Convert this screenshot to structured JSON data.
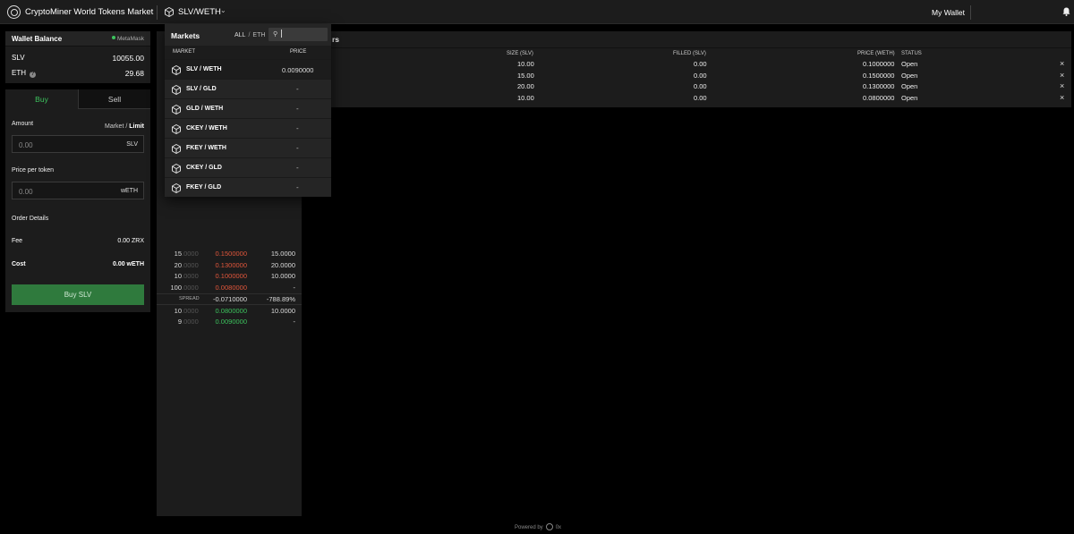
{
  "header": {
    "app_title": "CryptoMiner World Tokens Market",
    "pair": "SLV/WETH",
    "wallet_link": "My Wallet"
  },
  "wallet": {
    "title": "Wallet Balance",
    "provider": "MetaMask",
    "balances": [
      {
        "token": "SLV",
        "value": "10055.00"
      },
      {
        "token": "ETH",
        "value": "29.68"
      }
    ]
  },
  "order_form": {
    "tab_buy": "Buy",
    "tab_sell": "Sell",
    "amount_label": "Amount",
    "mode_market": "Market",
    "mode_sep": "/",
    "mode_limit": "Limit",
    "amount_placeholder": "0.00",
    "amount_unit": "SLV",
    "price_label": "Price per token",
    "price_placeholder": "0.00",
    "price_unit": "wETH",
    "details_label": "Order Details",
    "fee_label": "Fee",
    "fee_value": "0.00 ZRX",
    "cost_label": "Cost",
    "cost_value": "0.00 wETH",
    "submit": "Buy SLV"
  },
  "orderbook": {
    "asks": [
      {
        "size": "15",
        "size_dec": ".0000",
        "price": "0.1500000",
        "mine": "15.0000"
      },
      {
        "size": "20",
        "size_dec": ".0000",
        "price": "0.1300000",
        "mine": "20.0000"
      },
      {
        "size": "10",
        "size_dec": ".0000",
        "price": "0.1000000",
        "mine": "10.0000"
      },
      {
        "size": "100",
        "size_dec": ".0000",
        "price": "0.0080000",
        "mine": "-"
      }
    ],
    "spread_label": "SPREAD",
    "spread_value": "-0.0710000",
    "spread_pct": "-788.89%",
    "bids": [
      {
        "size": "10",
        "size_dec": ".0000",
        "price": "0.0800000",
        "mine": "10.0000"
      },
      {
        "size": "9",
        "size_dec": ".0000",
        "price": "0.0090000",
        "mine": "-"
      }
    ]
  },
  "orders": {
    "title_fragment": "rs",
    "columns": [
      "SIZE (SLV)",
      "FILLED (SLV)",
      "PRICE (WETH)",
      "STATUS"
    ],
    "rows": [
      {
        "size": "10.00",
        "filled": "0.00",
        "price": "0.1000000",
        "status": "Open"
      },
      {
        "size": "15.00",
        "filled": "0.00",
        "price": "0.1500000",
        "status": "Open"
      },
      {
        "size": "20.00",
        "filled": "0.00",
        "price": "0.1300000",
        "status": "Open"
      },
      {
        "size": "10.00",
        "filled": "0.00",
        "price": "0.0800000",
        "status": "Open"
      }
    ],
    "cancel_glyph": "×"
  },
  "markets_dropdown": {
    "title": "Markets",
    "filter_all": "ALL",
    "filter_sep": "/",
    "filter_eth": "ETH",
    "col_market": "MARKET",
    "col_price": "PRICE",
    "rows": [
      {
        "market": "SLV / WETH",
        "price": "0.0090000"
      },
      {
        "market": "SLV / GLD",
        "price": "-"
      },
      {
        "market": "GLD / WETH",
        "price": "-"
      },
      {
        "market": "CKEY / WETH",
        "price": "-"
      },
      {
        "market": "FKEY / WETH",
        "price": "-"
      },
      {
        "market": "CKEY / GLD",
        "price": "-"
      },
      {
        "market": "FKEY / GLD",
        "price": "-"
      }
    ]
  },
  "footer": {
    "powered_by": "Powered by",
    "brand": "0x"
  },
  "colors": {
    "buy_green": "#3cc25d",
    "sell_red": "#e0563b",
    "panel": "#1c1c1c"
  },
  "icons": [
    "app-logo-icon",
    "cube-icon",
    "chevron-down-icon",
    "bell-icon",
    "info-icon",
    "search-icon",
    "close-icon"
  ]
}
